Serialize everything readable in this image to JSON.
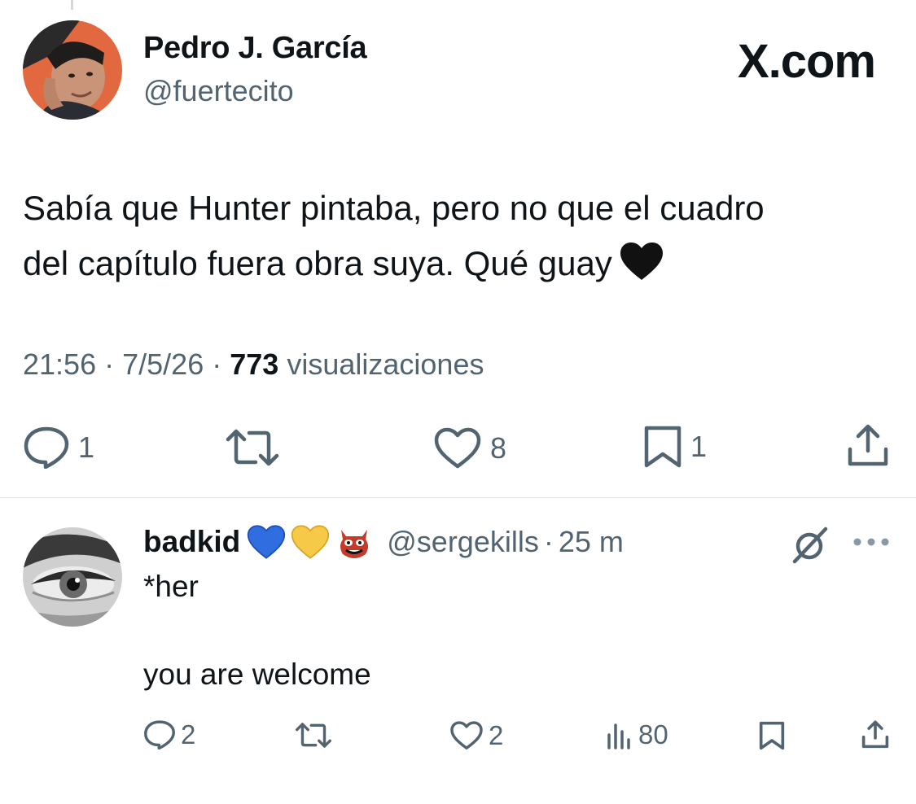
{
  "brand": "X.com",
  "main_tweet": {
    "author_name": "Pedro J. García",
    "author_handle": "@fuertecito",
    "text_line1": "Sabía que Hunter pintaba, pero no que el cuadro",
    "text_line2": "del capítulo fuera obra suya. Qué guay",
    "emoji": "black-heart",
    "time": "21:56",
    "date": "7/5/26",
    "separator": "·",
    "views_count": "773",
    "views_label": "visualizaciones",
    "actions": {
      "replies": "1",
      "reposts": "",
      "likes": "8",
      "bookmarks": "1"
    },
    "icons": {
      "reply": "reply-icon",
      "repost": "repost-icon",
      "like": "like-icon",
      "bookmark": "bookmark-icon",
      "share": "share-icon"
    }
  },
  "reply": {
    "author_name": "badkid",
    "badges": [
      "blue-heart",
      "yellow-heart",
      "ogre-mask"
    ],
    "author_handle": "@sergekills",
    "separator": "·",
    "time": "25 m",
    "line1": "*her",
    "line2": "you are welcome",
    "actions": {
      "replies": "2",
      "reposts": "",
      "likes": "2",
      "views": "80"
    },
    "icons": {
      "grok": "grok-icon",
      "more": "more-icon",
      "reply": "reply-icon",
      "repost": "repost-icon",
      "like": "like-icon",
      "views": "views-icon",
      "bookmark": "bookmark-icon",
      "share": "share-icon"
    }
  },
  "colors": {
    "text": "#0f1419",
    "secondary": "#536471",
    "divider": "#dfe3e6",
    "background": "#ffffff"
  }
}
